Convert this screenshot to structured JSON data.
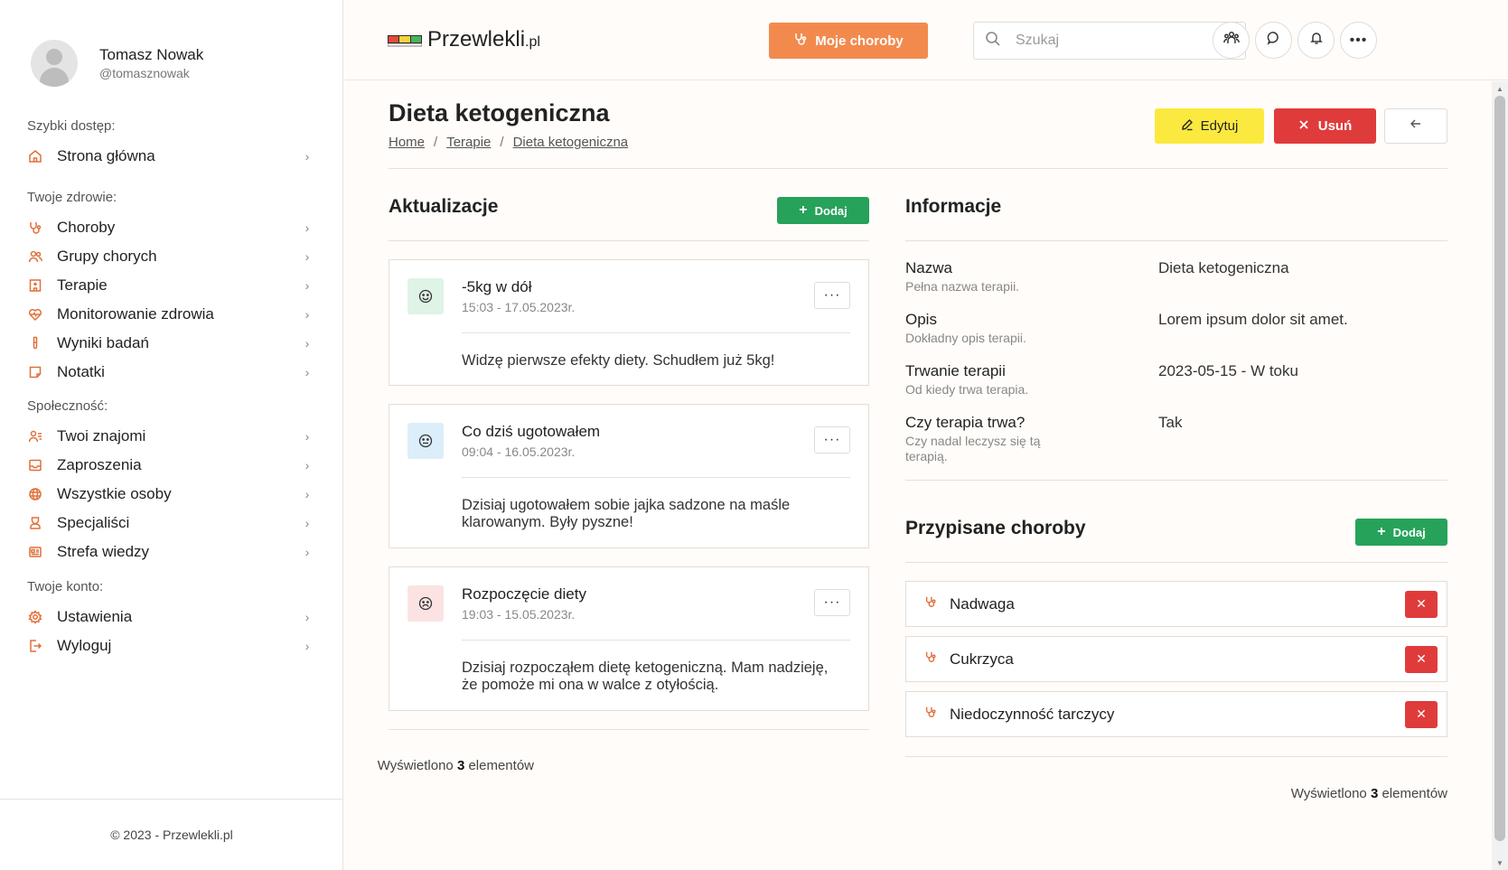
{
  "user": {
    "name": "Tomasz Nowak",
    "handle": "@tomasznowak"
  },
  "nav": {
    "quick": {
      "heading": "Szybki dostęp:",
      "items": [
        {
          "label": "Strona główna",
          "icon": "home-icon"
        }
      ]
    },
    "health": {
      "heading": "Twoje zdrowie:",
      "items": [
        {
          "label": "Choroby",
          "icon": "stethoscope-icon"
        },
        {
          "label": "Grupy chorych",
          "icon": "users-icon"
        },
        {
          "label": "Terapie",
          "icon": "hospital-icon"
        },
        {
          "label": "Monitorowanie zdrowia",
          "icon": "heart-pulse-icon"
        },
        {
          "label": "Wyniki badań",
          "icon": "test-tube-icon"
        },
        {
          "label": "Notatki",
          "icon": "note-icon"
        }
      ]
    },
    "community": {
      "heading": "Społeczność:",
      "items": [
        {
          "label": "Twoi znajomi",
          "icon": "user-list-icon"
        },
        {
          "label": "Zaproszenia",
          "icon": "inbox-icon"
        },
        {
          "label": "Wszystkie osoby",
          "icon": "globe-icon"
        },
        {
          "label": "Specjaliści",
          "icon": "specialist-icon"
        },
        {
          "label": "Strefa wiedzy",
          "icon": "newspaper-icon"
        }
      ]
    },
    "account": {
      "heading": "Twoje konto:",
      "items": [
        {
          "label": "Ustawienia",
          "icon": "gear-icon"
        },
        {
          "label": "Wyloguj",
          "icon": "logout-icon"
        }
      ]
    }
  },
  "footer": {
    "copyright": "© 2023 - Przewlekli.pl"
  },
  "topbar": {
    "logo_main": "Przewlekli",
    "logo_suffix": ".pl",
    "my_diseases": "Moje choroby",
    "search_placeholder": "Szukaj"
  },
  "page": {
    "title": "Dieta ketogeniczna",
    "breadcrumb": [
      "Home",
      "Terapie",
      "Dieta ketogeniczna"
    ],
    "edit": "Edytuj",
    "delete": "Usuń"
  },
  "updates": {
    "title": "Aktualizacje",
    "add": "Dodaj",
    "items": [
      {
        "title": "-5kg w dół",
        "date": "15:03 - 17.05.2023r.",
        "body": "Widzę pierwsze efekty diety. Schudłem już 5kg!",
        "mood": "happy",
        "color": "#dff3e7"
      },
      {
        "title": "Co dziś ugotowałem",
        "date": "09:04 - 16.05.2023r.",
        "body": "Dzisiaj ugotowałem sobie jajka sadzone na maśle klarowanym. Były pyszne!",
        "mood": "neutral",
        "color": "#dceefa"
      },
      {
        "title": "Rozpoczęcie diety",
        "date": "19:03 - 15.05.2023r.",
        "body": "Dzisiaj rozpocząłem dietę ketogeniczną. Mam nadzieję, że pomoże mi ona w walce z otyłością.",
        "mood": "sad",
        "color": "#fbe3e3"
      }
    ],
    "count_prefix": "Wyświetlono",
    "count": "3",
    "count_suffix": "elementów"
  },
  "info": {
    "title": "Informacje",
    "rows": [
      {
        "label": "Nazwa",
        "sub": "Pełna nazwa terapii.",
        "value": "Dieta ketogeniczna"
      },
      {
        "label": "Opis",
        "sub": "Dokładny opis terapii.",
        "value": "Lorem ipsum dolor sit amet."
      },
      {
        "label": "Trwanie terapii",
        "sub": "Od kiedy trwa terapia.",
        "value": "2023-05-15 - W toku"
      },
      {
        "label": "Czy terapia trwa?",
        "sub": "Czy nadal leczysz się tą terapią.",
        "value": "Tak"
      }
    ]
  },
  "diseases": {
    "title": "Przypisane choroby",
    "add": "Dodaj",
    "items": [
      "Nadwaga",
      "Cukrzyca",
      "Niedoczynność tarczycy"
    ],
    "count_prefix": "Wyświetlono",
    "count": "3",
    "count_suffix": "elementów"
  },
  "colors": {
    "accent": "#f28a4e",
    "danger": "#e03b3b",
    "success": "#27a25a",
    "warning": "#fbe93f"
  }
}
